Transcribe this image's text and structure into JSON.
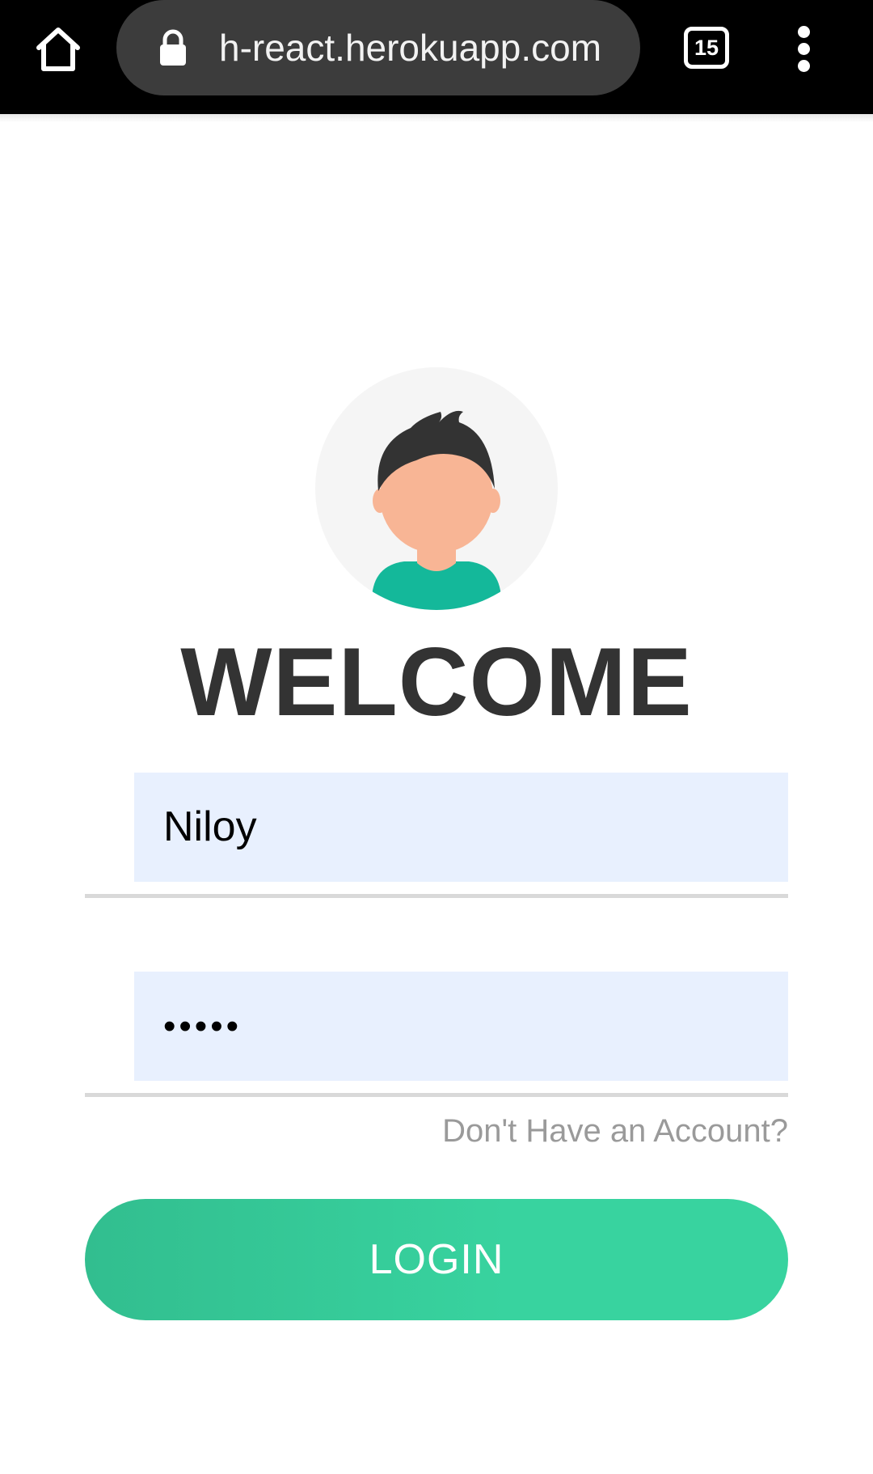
{
  "browser": {
    "url": "h-react.herokuapp.com",
    "tab_count": "15",
    "icons": {
      "home": "home-icon",
      "lock": "lock-icon",
      "tabs": "tab-switcher-icon",
      "menu": "more-vert-icon"
    }
  },
  "login": {
    "avatar_icon": "user-avatar-icon",
    "title": "WELCOME",
    "username_value": "Niloy",
    "password_value": "•••••",
    "signup_link": "Don't Have an Account?",
    "login_button": "LOGIN"
  },
  "colors": {
    "browser_bar": "#000000",
    "url_pill": "#3c3c3c",
    "input_bg": "#e8f0fe",
    "title": "#333333",
    "link": "#9a9a9a",
    "button_start": "#32be8f",
    "button_end": "#38d39f",
    "avatar_shirt": "#14b89a",
    "avatar_skin": "#f8b595",
    "avatar_hair": "#333333"
  }
}
